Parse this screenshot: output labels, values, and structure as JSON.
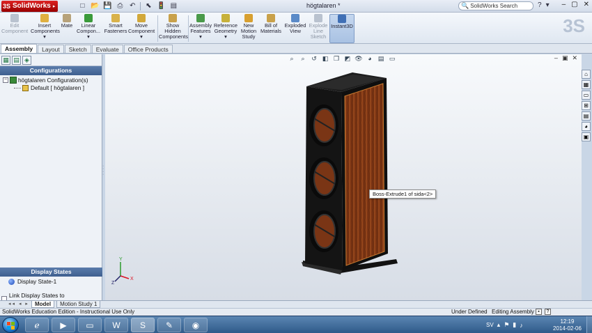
{
  "titlebar": {
    "app_name": "SolidWorks",
    "doc_title": "högtalaren *",
    "search_placeholder": "SolidWorks Search",
    "help_icon": "?",
    "minimize": "–",
    "restore": "▢",
    "close": "✕"
  },
  "ribbon": {
    "buttons": [
      {
        "label": "Edit Component",
        "name": "edit-component",
        "disabled": true
      },
      {
        "label": "Insert Components",
        "name": "insert-components"
      },
      {
        "label": "Mate",
        "name": "mate"
      },
      {
        "label": "Linear Compon...",
        "name": "linear-component-pattern"
      },
      {
        "label": "Smart Fasteners",
        "name": "smart-fasteners"
      },
      {
        "label": "Move Component",
        "name": "move-component"
      },
      {
        "label": "Show Hidden Components",
        "name": "show-hidden-components"
      },
      {
        "label": "Assembly Features",
        "name": "assembly-features"
      },
      {
        "label": "Reference Geometry",
        "name": "reference-geometry"
      },
      {
        "label": "New Motion Study",
        "name": "new-motion-study"
      },
      {
        "label": "Bill of Materials",
        "name": "bill-of-materials"
      },
      {
        "label": "Exploded View",
        "name": "exploded-view"
      },
      {
        "label": "Explode Line Sketch",
        "name": "explode-line-sketch",
        "disabled": true
      },
      {
        "label": "Instant3D",
        "name": "instant3d",
        "active": true
      }
    ]
  },
  "tabs": [
    "Assembly",
    "Layout",
    "Sketch",
    "Evaluate",
    "Office Products"
  ],
  "left_panel": {
    "header": "Configurations",
    "root_label": "högtalaren Configuration(s)",
    "child_label": "Default [ högtalaren ]",
    "display_states_header": "Display States",
    "display_state_item": "Display State-1",
    "link_checkbox_label": "Link Display States to Configurations"
  },
  "viewport": {
    "tooltip": "Boss-Extrude1 of sida<2>"
  },
  "bottom_tabs": [
    "Model",
    "Motion Study 1"
  ],
  "statusbar": {
    "left_text": "SolidWorks Education Edition - Instructional Use Only",
    "under_defined": "Under Defined",
    "editing": "Editing Assembly"
  },
  "taskbar": {
    "lang": "SV",
    "time": "12:19",
    "date": "2014-02-06"
  },
  "colors": {
    "wood": "#8a3d16",
    "cabinet": "#1a1a1a",
    "accent": "#3e5f8f"
  }
}
